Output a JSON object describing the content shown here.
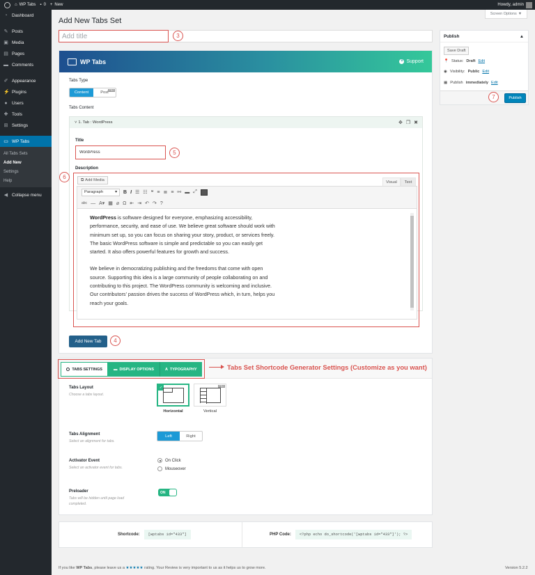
{
  "adminbar": {
    "site": "WP Tabs",
    "comments": "0",
    "new": "New",
    "howdy": "Howdy, admin"
  },
  "sidebar": {
    "items": [
      {
        "label": "Dashboard",
        "icon": "dashboard-icon"
      },
      {
        "label": "Posts",
        "icon": "pin-icon"
      },
      {
        "label": "Media",
        "icon": "media-icon"
      },
      {
        "label": "Pages",
        "icon": "pages-icon"
      },
      {
        "label": "Comments",
        "icon": "comments-icon"
      },
      {
        "label": "Appearance",
        "icon": "brush-icon"
      },
      {
        "label": "Plugins",
        "icon": "plug-icon"
      },
      {
        "label": "Users",
        "icon": "users-icon"
      },
      {
        "label": "Tools",
        "icon": "wrench-icon"
      },
      {
        "label": "Settings",
        "icon": "settings-icon"
      },
      {
        "label": "WP Tabs",
        "icon": "tabs-icon"
      }
    ],
    "submenu": [
      "All Tabs Sets",
      "Add New",
      "Settings",
      "Help"
    ],
    "collapse": "Collapse menu"
  },
  "screen_options": "Screen Options",
  "page_title": "Add New Tabs Set",
  "title_placeholder": "Add title",
  "callouts": {
    "title": "3",
    "addtab": "4",
    "tabtitle": "5",
    "description": "6",
    "publish": "7"
  },
  "metabox": {
    "brand": "WP Tabs",
    "support": "Support",
    "tabs_type_label": "Tabs Type",
    "tabs_type_options": [
      "Content",
      "Post"
    ],
    "pro_badge": "PRO",
    "tabs_content_label": "Tabs Content",
    "tab_header": "1. Tab : WordPress",
    "title_label": "Title",
    "title_value": "WordPress",
    "description_label": "Description",
    "add_media": "Add Media",
    "editor_tabs": [
      "Visual",
      "Text"
    ],
    "paragraph_select": "Paragraph",
    "content_p1_bold": "WordPress",
    "content_p1": " is software designed for everyone, emphasizing accessibility, performance, security, and ease of use. We believe great software should work with minimum set up, so you can focus on sharing your story, product, or services freely. The basic WordPress software is simple and predictable so you can easily get started. It also offers powerful features for growth and success.",
    "content_p2": "We believe in democratizing publishing and the freedoms that come with open source. Supporting this idea is a large community of people collaborating on and contributing to this project. The WordPress community is welcoming and inclusive. Our contributors’ passion drives the success of WordPress which, in turn, helps you reach your goals.",
    "add_new_tab": "Add New Tab"
  },
  "settings": {
    "tabs": [
      "TABS SETTINGS",
      "DISPLAY OPTIONS",
      "TYPOGRAPHY"
    ],
    "annotation": "Tabs Set Shortcode Generator Settings (Customize as you want)",
    "layout_label": "Tabs Layout",
    "layout_help": "Choose a tabs layout.",
    "layout_options": [
      "Horizontal",
      "Vertical"
    ],
    "alignment_label": "Tabs Alignment",
    "alignment_help": "Select an alignment for tabs.",
    "alignment_options": [
      "Left",
      "Right"
    ],
    "activator_label": "Activator Event",
    "activator_help": "Select an activator event for tabs.",
    "activator_options": [
      "On Click",
      "Mouseover"
    ],
    "preloader_label": "Preloader",
    "preloader_help": "Tabs will be hidden until page load completed.",
    "preloader_toggle": "ON"
  },
  "shortcode": {
    "label": "Shortcode:",
    "value": "[wptabs id=\"433\"]",
    "php_label": "PHP Code:",
    "php_value": "<?php echo do_shortcode('[wptabs id=\"433\"]'); ?>"
  },
  "publish": {
    "title": "Publish",
    "save_draft": "Save Draft",
    "status_label": "Status:",
    "status_value": "Draft",
    "visibility_label": "Visibility:",
    "visibility_value": "Public",
    "schedule_label": "Publish",
    "schedule_value": "immediately",
    "edit": "Edit",
    "button": "Publish"
  },
  "footer": {
    "pre": "If you like ",
    "brand": "WP Tabs",
    "mid": ", please leave us a ",
    "stars": "★★★★★",
    "post": " rating. Your Review is very important to us as it helps us to grow more.",
    "version": "Version 5.2.2"
  },
  "colors": {
    "accent": "#0073aa",
    "green": "#26b583",
    "annotation": "#d9534f"
  }
}
